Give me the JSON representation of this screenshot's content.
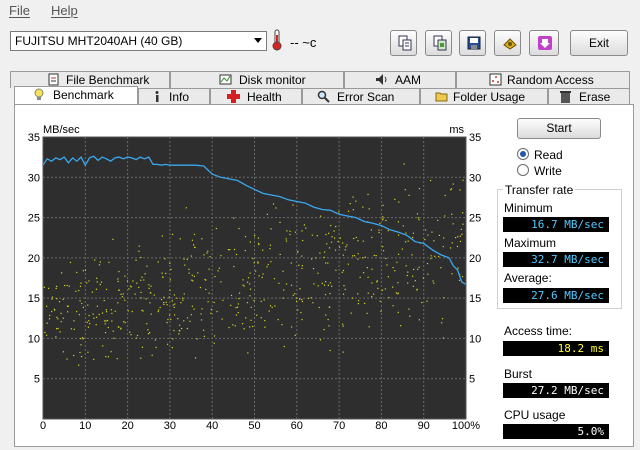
{
  "menu": {
    "file": "File",
    "help": "Help"
  },
  "toolbar": {
    "drive": "FUJITSU MHT2040AH (40 GB)",
    "temperature": "-- ~c",
    "exit_label": "Exit",
    "icons": [
      "copy-text-icon",
      "copy-screenshot-icon",
      "save-icon",
      "options-icon",
      "download-icon"
    ]
  },
  "tabs_top": [
    {
      "label": "File Benchmark",
      "icon": "file-benchmark-icon"
    },
    {
      "label": "Disk monitor",
      "icon": "disk-monitor-icon"
    },
    {
      "label": "AAM",
      "icon": "speaker-icon"
    },
    {
      "label": "Random Access",
      "icon": "random-access-icon"
    }
  ],
  "tabs_bottom": [
    {
      "label": "Benchmark",
      "icon": "lightbulb-icon",
      "active": true
    },
    {
      "label": "Info",
      "icon": "info-icon"
    },
    {
      "label": "Health",
      "icon": "health-cross-icon"
    },
    {
      "label": "Error Scan",
      "icon": "magnifier-icon"
    },
    {
      "label": "Folder Usage",
      "icon": "folder-icon"
    },
    {
      "label": "Erase",
      "icon": "trash-icon"
    }
  ],
  "controls": {
    "start_label": "Start",
    "read_label": "Read",
    "write_label": "Write",
    "mode": "Read"
  },
  "stats": {
    "transfer_rate_title": "Transfer rate",
    "minimum_label": "Minimum",
    "minimum_value": "16.7 MB/sec",
    "maximum_label": "Maximum",
    "maximum_value": "32.7 MB/sec",
    "average_label": "Average:",
    "average_value": "27.6 MB/sec",
    "access_time_label": "Access time:",
    "access_time_value": "18.2 ms",
    "burst_label": "Burst",
    "burst_value": "27.2 MB/sec",
    "cpu_label": "CPU usage",
    "cpu_value": "5.0%"
  },
  "colors": {
    "chart_bg": "#2e2e2e",
    "grid": "#6a6a6a",
    "transfer_line": "#3aa8f0",
    "access_dots": "#d8d820"
  },
  "chart_data": {
    "type": "line",
    "title": "",
    "y_left_label": "MB/sec",
    "y_right_label": "ms",
    "ylim": [
      0,
      35
    ],
    "xlim": [
      0,
      100
    ],
    "y_ticks": [
      5,
      10,
      15,
      20,
      25,
      30,
      35
    ],
    "x_ticks": [
      "0",
      "10",
      "20",
      "30",
      "40",
      "50",
      "60",
      "70",
      "80",
      "90",
      "100%"
    ],
    "grid": true,
    "series": [
      {
        "x": [
          0,
          1,
          2,
          3,
          4,
          5,
          6,
          7,
          8,
          9,
          10,
          11,
          12,
          13,
          14,
          15,
          16,
          17,
          18,
          19,
          20,
          21,
          22,
          23,
          24,
          25,
          26,
          27,
          28,
          29,
          30,
          32,
          34,
          36,
          38,
          40,
          42,
          44,
          46,
          48,
          50,
          52,
          54,
          56,
          58,
          60,
          62,
          64,
          66,
          68,
          70,
          72,
          74,
          76,
          78,
          80,
          82,
          84,
          86,
          88,
          90,
          92,
          94,
          96,
          97,
          98,
          99,
          100
        ],
        "y": [
          31.5,
          32.3,
          32.0,
          32.4,
          32.2,
          32.5,
          31.8,
          32.4,
          32.0,
          32.5,
          31.5,
          32.4,
          32.6,
          32.1,
          32.5,
          32.3,
          32.0,
          32.4,
          32.5,
          32.3,
          32.5,
          32.4,
          32.2,
          32.5,
          32.3,
          32.5,
          31.6,
          31.6,
          31.5,
          31.6,
          31.5,
          31.5,
          31.5,
          31.5,
          31.4,
          30.4,
          30.0,
          29.8,
          29.6,
          29.0,
          28.5,
          28.0,
          27.8,
          27.6,
          27.2,
          27.0,
          26.8,
          26.3,
          26.0,
          25.9,
          25.4,
          25.2,
          25.0,
          24.5,
          24.3,
          24.0,
          23.5,
          23.2,
          22.8,
          22.0,
          21.8,
          21.0,
          20.4,
          20.0,
          19.0,
          18.5,
          17.0,
          16.7
        ]
      }
    ],
    "access_time_range_ms": [
      5,
      32
    ],
    "access_time_average_ms": 18.2
  }
}
